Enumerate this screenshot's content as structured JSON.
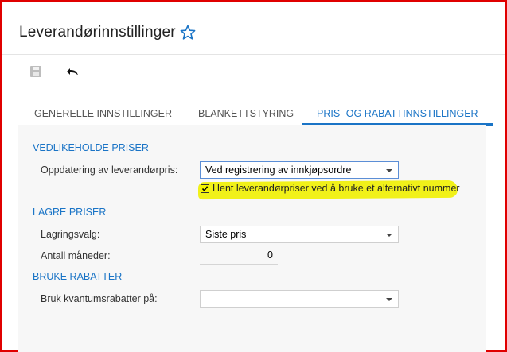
{
  "header": {
    "title": "Leverandørinnstillinger"
  },
  "toolbar": {
    "save_icon": "save-icon",
    "undo_icon": "undo-icon"
  },
  "tabs": [
    {
      "label": "GENERELLE INNSTILLINGER",
      "active": false
    },
    {
      "label": "BLANKETTSTYRING",
      "active": false
    },
    {
      "label": "PRIS- OG RABATTINNSTILLINGER",
      "active": true
    }
  ],
  "sections": {
    "maintain": {
      "title": "VEDLIKEHOLDE PRISER",
      "update_label": "Oppdatering av leverandørpris:",
      "update_value": "Ved registrering av innkjøpsordre",
      "alt_number_label": "Hent leverandørpriser ved å bruke et alternativt nummer",
      "alt_number_checked": true
    },
    "store": {
      "title": "LAGRE PRISER",
      "storage_label": "Lagringsvalg:",
      "storage_value": "Siste pris",
      "months_label": "Antall måneder:",
      "months_value": "0"
    },
    "discounts": {
      "title": "BRUKE RABATTER",
      "volume_label": "Bruk kvantumsrabatter på:",
      "volume_value": ""
    }
  },
  "colors": {
    "accent": "#1a74c6",
    "highlight": "#f0f000",
    "frame": "#e00000"
  }
}
